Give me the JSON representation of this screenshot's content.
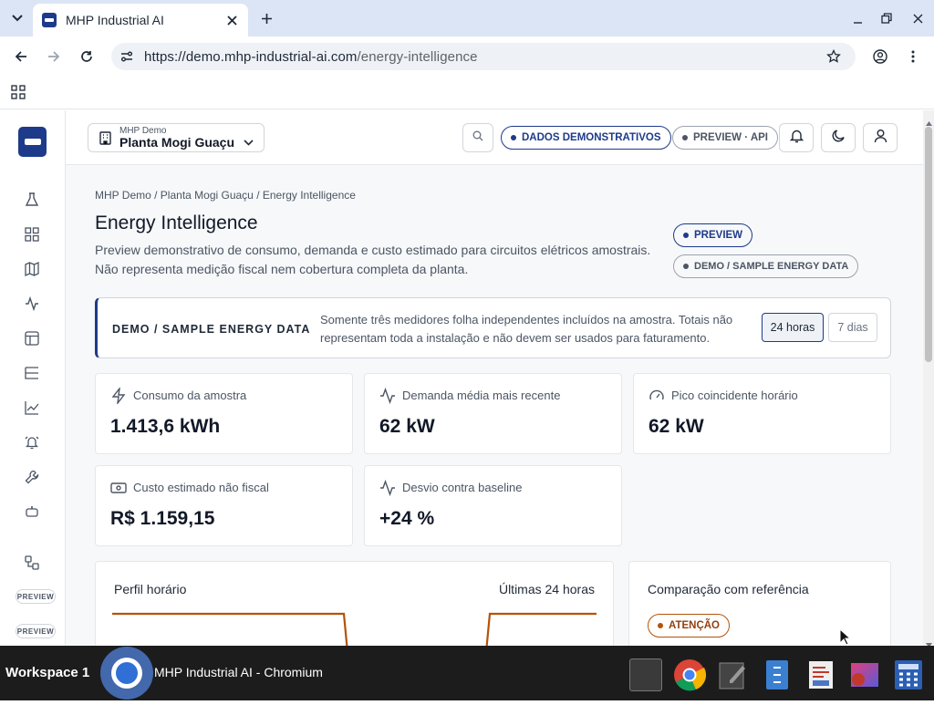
{
  "browser": {
    "tab_title": "MHP Industrial AI",
    "url_host": "https://demo.mhp-industrial-ai.com",
    "url_path": "/energy-intelligence"
  },
  "header": {
    "org": "MHP Demo",
    "plant": "Planta Mogi Guaçu",
    "badge_demo": "DADOS DEMONSTRATIVOS",
    "badge_preview": "PREVIEW · API"
  },
  "sidebar": {
    "items": [
      "flask-icon",
      "grid-icon",
      "map-icon",
      "activity-icon",
      "layout-icon",
      "list-tree-icon",
      "chart-icon",
      "alarm-bell-icon",
      "wrench-icon",
      "robot-icon",
      "integration-icon"
    ],
    "preview_1": "PREVIEW",
    "preview_2": "PREVIEW"
  },
  "page": {
    "breadcrumb": "MHP Demo / Planta Mogi Guaçu / Energy Intelligence",
    "title": "Energy Intelligence",
    "desc_line1": "Preview demonstrativo de consumo, demanda e custo estimado para circuitos elétricos amostrais.",
    "desc_line2": "Não representa medição fiscal nem cobertura completa da planta.",
    "pill_preview": "PREVIEW",
    "pill_sample": "DEMO / SAMPLE ENERGY DATA"
  },
  "banner": {
    "title": "DEMO / SAMPLE ENERGY DATA",
    "text": "Somente três medidores folha independentes incluídos na amostra. Totais não representam toda a instalação e não devem ser usados para faturamento.",
    "range_24h": "24 horas",
    "range_7d": "7 dias",
    "selected": "24 horas"
  },
  "kpis": [
    {
      "label": "Consumo da amostra",
      "value": "1.413,6 kWh",
      "icon": "zap-icon"
    },
    {
      "label": "Demanda média mais recente",
      "value": "62 kW",
      "icon": "activity-icon"
    },
    {
      "label": "Pico coincidente horário",
      "value": "62 kW",
      "icon": "gauge-icon"
    },
    {
      "label": "Custo estimado não fiscal",
      "value": "R$ 1.159,15",
      "icon": "banknote-icon"
    },
    {
      "label": "Desvio contra baseline",
      "value": "+24 %",
      "icon": "activity-icon"
    }
  ],
  "profile": {
    "title": "Perfil horário",
    "range": "Últimas 24 horas",
    "line_color": "#b45309"
  },
  "comparison": {
    "title": "Comparação com referência",
    "status": "ATENÇÃO"
  },
  "taskbar": {
    "workspace": "Workspace 1",
    "app": "MHP Industrial AI - Chromium"
  },
  "colors": {
    "brand": "#1e3a8a",
    "warning": "#b45309",
    "background": "#f7f8fa"
  }
}
